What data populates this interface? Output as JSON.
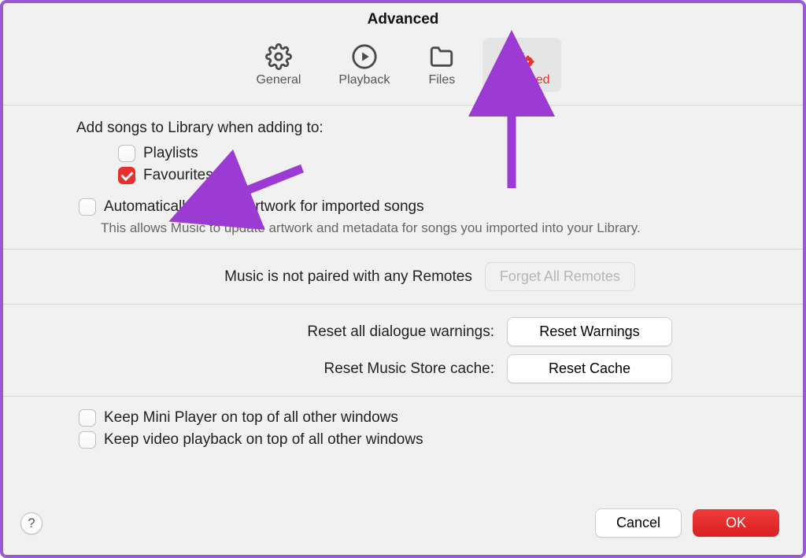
{
  "title": "Advanced",
  "tabs": {
    "general": "General",
    "playback": "Playback",
    "files": "Files",
    "advanced": "Advanced"
  },
  "library": {
    "heading": "Add songs to Library when adding to:",
    "playlists": "Playlists",
    "favourites": "Favourites",
    "playlists_checked": false,
    "favourites_checked": true
  },
  "artwork": {
    "label": "Automatically update artwork for imported songs",
    "desc": "This allows Music to update artwork and metadata for songs you imported into your Library.",
    "checked": false
  },
  "remotes": {
    "status": "Music is not paired with any Remotes",
    "button": "Forget All Remotes"
  },
  "reset": {
    "warn_label": "Reset all dialogue warnings:",
    "warn_btn": "Reset Warnings",
    "cache_label": "Reset Music Store cache:",
    "cache_btn": "Reset Cache"
  },
  "keep": {
    "mini": "Keep Mini Player on top of all other windows",
    "video": "Keep video playback on top of all other windows",
    "mini_checked": false,
    "video_checked": false
  },
  "footer": {
    "help": "?",
    "cancel": "Cancel",
    "ok": "OK"
  },
  "colors": {
    "accent": "#e7302e",
    "annotation": "#9b3bd3"
  }
}
